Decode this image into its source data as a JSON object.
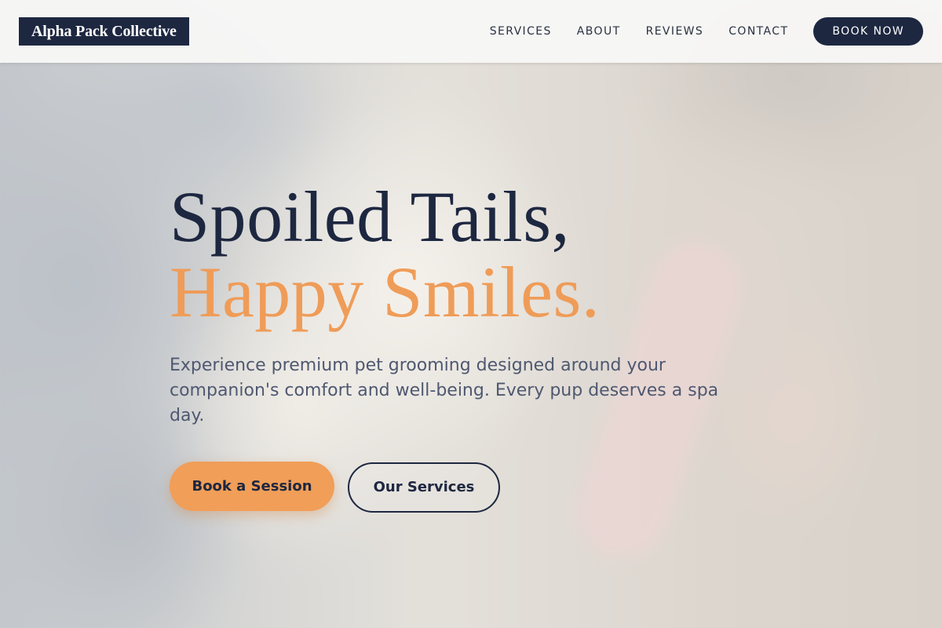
{
  "header": {
    "logo_text": "Alpha Pack Collective",
    "nav": [
      {
        "label": "SERVICES"
      },
      {
        "label": "ABOUT"
      },
      {
        "label": "REVIEWS"
      },
      {
        "label": "CONTACT"
      }
    ],
    "cta_label": "BOOK NOW"
  },
  "hero": {
    "headline_line1": "Spoiled Tails,",
    "headline_line2": "Happy Smiles.",
    "subtitle": "Experience premium pet grooming designed around your companion's comfort and well-being. Every pup deserves a spa day.",
    "primary_button": "Book a Session",
    "secondary_button": "Our Services"
  },
  "colors": {
    "navy": "#1d2740",
    "accent_orange": "#f09e58",
    "body_text": "#4e5870"
  }
}
